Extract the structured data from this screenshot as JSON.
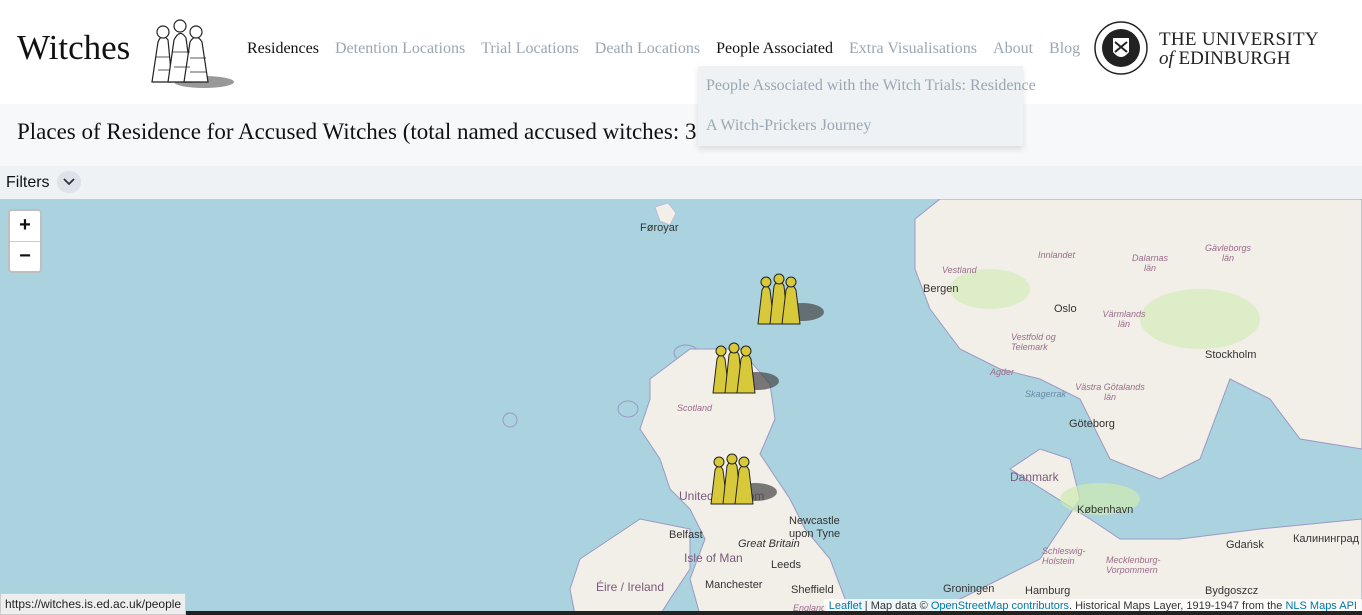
{
  "header": {
    "brand": "Witches",
    "nav": [
      {
        "label": "Residences"
      },
      {
        "label": "Detention Locations"
      },
      {
        "label": "Trial Locations"
      },
      {
        "label": "Death Locations"
      },
      {
        "label": "People Associated"
      },
      {
        "label": "Extra Visualisations"
      },
      {
        "label": "About"
      },
      {
        "label": "Blog"
      }
    ],
    "university": {
      "line1": "THE UNIVERSITY",
      "line2_of": "of",
      "line2": "EDINBURGH"
    }
  },
  "dropdown": {
    "items": [
      {
        "label": "People Associated with the Witch Trials: Residence"
      },
      {
        "label": "A Witch-Prickers Journey"
      }
    ]
  },
  "title": "Places of Residence for Accused Witches (total named accused witches: 314)",
  "filters": {
    "label": "Filters"
  },
  "map": {
    "zoom_in": "+",
    "zoom_out": "−",
    "labels": {
      "faroe": "Føroyar",
      "scotland": "Scotland",
      "uk": "United Kingdom",
      "belfast": "Belfast",
      "isle_of_man": "Isle of Man",
      "great_britain": "Great Britain",
      "eire": "Éire / Ireland",
      "manchester": "Manchester",
      "leeds": "Leeds",
      "sheffield": "Sheffield",
      "newcastle": "Newcastle upon Tyne",
      "bergen": "Bergen",
      "oslo": "Oslo",
      "stockholm": "Stockholm",
      "goteborg": "Göteborg",
      "danmark": "Danmark",
      "kobenhavn": "København",
      "gdansk": "Gdańsk",
      "kaliningrad": "Калининград",
      "hamburg": "Hamburg",
      "groningen": "Groningen",
      "bydgoszcz": "Bydgoszcz",
      "vestland": "Vestland",
      "innlandet": "Innlandet",
      "dalarnas": "Dalarnas län",
      "gavleborgs": "Gävleborgs län",
      "varmlands": "Värmlands län",
      "vestfold": "Vestfold og Telemark",
      "agder": "Agder",
      "vastra": "Västra Götalands län",
      "skagerrak": "Skagerrak",
      "schleswig": "Schleswig-Holstein",
      "mecklenburg": "Mecklenburg-Vorpommern",
      "england": "England"
    },
    "attribution": {
      "leaflet": "Leaflet",
      "sep": " | Map data © ",
      "osm": "OpenStreetMap contributors",
      "hist": ". Historical Maps Layer, 1919-1947 from the ",
      "nls": "NLS Maps API"
    }
  },
  "status_url": "https://witches.is.ed.ac.uk/people",
  "colors": {
    "sea": "#aad3df",
    "land": "#f2efe9",
    "marker": "#d7c93a",
    "link": "#0078a8"
  }
}
